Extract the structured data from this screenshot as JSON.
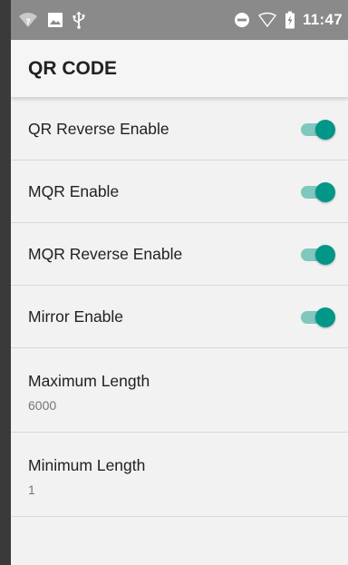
{
  "status_bar": {
    "time": "11:47",
    "icons_left": [
      "wifi-question-icon",
      "image-icon",
      "usb-icon"
    ],
    "icons_right": [
      "do-not-disturb-icon",
      "signal-icon",
      "battery-charging-icon"
    ]
  },
  "app_bar": {
    "title": "QR CODE"
  },
  "settings": [
    {
      "label": "QR Reverse Enable",
      "type": "toggle",
      "enabled": true
    },
    {
      "label": "MQR Enable",
      "type": "toggle",
      "enabled": true
    },
    {
      "label": "MQR Reverse Enable",
      "type": "toggle",
      "enabled": true
    },
    {
      "label": "Mirror Enable",
      "type": "toggle",
      "enabled": true
    },
    {
      "label": "Maximum Length",
      "type": "value",
      "value": "6000"
    },
    {
      "label": "Minimum Length",
      "type": "value",
      "value": "1"
    }
  ],
  "colors": {
    "accent": "#009688",
    "accent_track": "#7fc7bf",
    "status_bar": "#8a8a8a",
    "background": "#f2f2f2"
  }
}
